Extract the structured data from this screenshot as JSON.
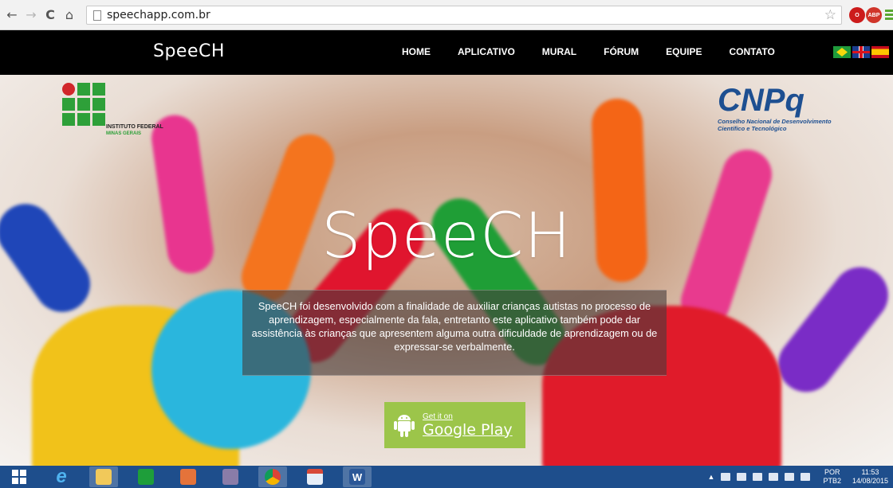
{
  "browser": {
    "url": "speechapp.com.br",
    "back_icon": "←",
    "forward_icon": "→",
    "reload_icon": "C",
    "home_icon": "⌂",
    "bookmark_icon": "☆",
    "ext_opera": "O",
    "ext_abp": "ABP"
  },
  "site": {
    "brand": "SpeeCH",
    "menu": [
      "HOME",
      "APLICATIVO",
      "MURAL",
      "FÓRUM",
      "EQUIPE",
      "CONTATO"
    ]
  },
  "logos": {
    "if_name": "INSTITUTO FEDERAL",
    "if_sub": "MINAS GERAIS",
    "cnpq_name": "CNPq",
    "cnpq_sub1": "Conselho Nacional de Desenvolvimento",
    "cnpq_sub2": "Científico e Tecnológico"
  },
  "hero": {
    "title": "SpeeCH",
    "description": "SpeeCH foi desenvolvido com a finalidade de auxiliar crianças autistas no processo de aprendizagem, especialmente da fala, entretanto este aplicativo também pode dar assistência às crianças que apresentem alguma outra dificuldade de aprendizagem ou de expressar-se verbalmente.",
    "cta_small": "Get it on",
    "cta_big": "Google Play"
  },
  "taskbar": {
    "lang_top": "POR",
    "lang_bottom": "PTB2",
    "time": "11:53",
    "date": "14/08/2015"
  }
}
